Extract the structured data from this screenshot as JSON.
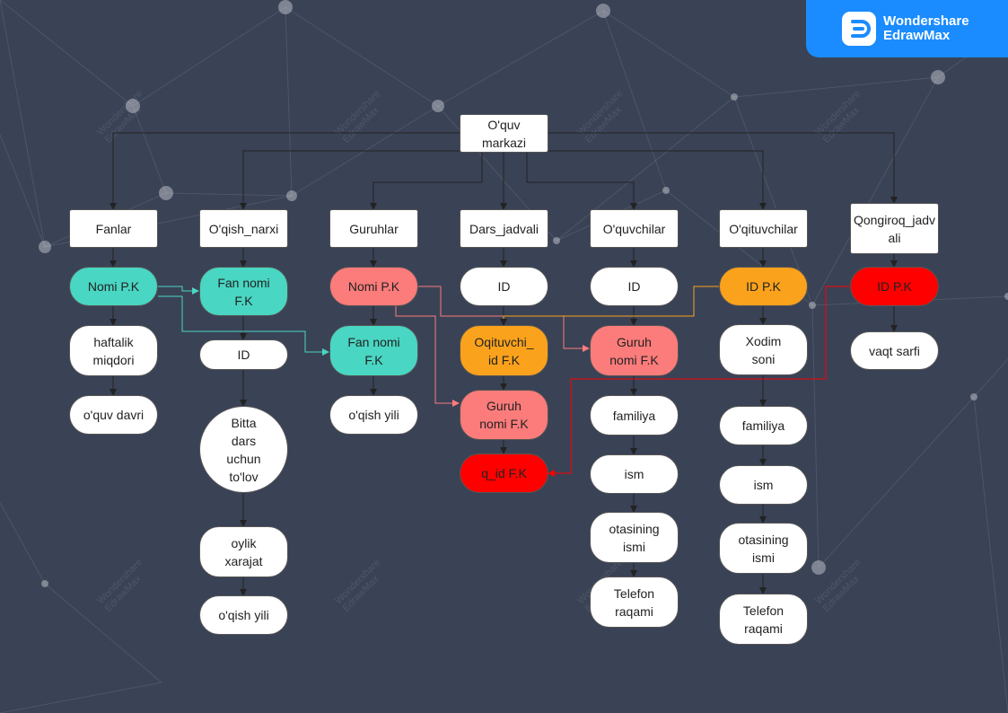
{
  "brand": {
    "line1": "Wondershare",
    "line2": "EdrawMax",
    "logo_icon": "edrawmax-logo-icon",
    "color": "#1a8cff"
  },
  "watermark": {
    "line1": "Wondershare",
    "line2": "EdrawMax"
  },
  "colors": {
    "background": "#3a4256",
    "teal": "#49d6c3",
    "salmon": "#fb7c7b",
    "orange": "#fba21c",
    "red": "#ff0000",
    "edge": "#222222"
  },
  "nodes": {
    "root": "O'quv markazi",
    "fanlar": "Fanlar",
    "oqish_narxi": "O'qish_narxi",
    "guruhlar": "Guruhlar",
    "dars_jadvali": "Dars_jadvali",
    "oquvchilar": "O'quvchilar",
    "oqituvchilar": "O'qituvchilar",
    "qongiroq": "Qongiroq_jadv\nali",
    "fanlar_nomi_pk": "Nomi P.K",
    "fanlar_haftalik": "haftalik\nmiqdori",
    "fanlar_oquv_davri": "o'quv davri",
    "narx_fan_nomi_fk": "Fan nomi\nF.K",
    "narx_id": "ID",
    "narx_bitta": "Bitta\ndars\nuchun\nto'lov",
    "narx_oylik": "oylik\nxarajat",
    "narx_oqish_yili": "o'qish yili",
    "guruh_nomi_pk": "Nomi P.K",
    "guruh_fan_nomi_fk": "Fan nomi\nF.K",
    "guruh_oqish_yili": "o'qish yili",
    "dars_id": "ID",
    "dars_oqituvchi_fk": "Oqituvchi_\nid F.K",
    "dars_guruh_fk": "Guruh\nnomi F.K",
    "dars_q_id_fk": "q_id F.K",
    "oquv_id": "ID",
    "oquv_guruh_fk": "Guruh\nnomi F.K",
    "oquv_familiya": "familiya",
    "oquv_ism": "ism",
    "oquv_otasining": "otasining\nismi",
    "oquv_telefon": "Telefon\nraqami",
    "oqit_id_pk": "ID P.K",
    "oqit_xodim": "Xodim\nsoni",
    "oqit_familiya": "familiya",
    "oqit_ism": "ism",
    "oqit_otasining": "otasining\nismi",
    "oqit_telefon": "Telefon\nraqami",
    "qong_id_pk": "ID P.K",
    "qong_vaqt": "vaqt sarfi"
  }
}
